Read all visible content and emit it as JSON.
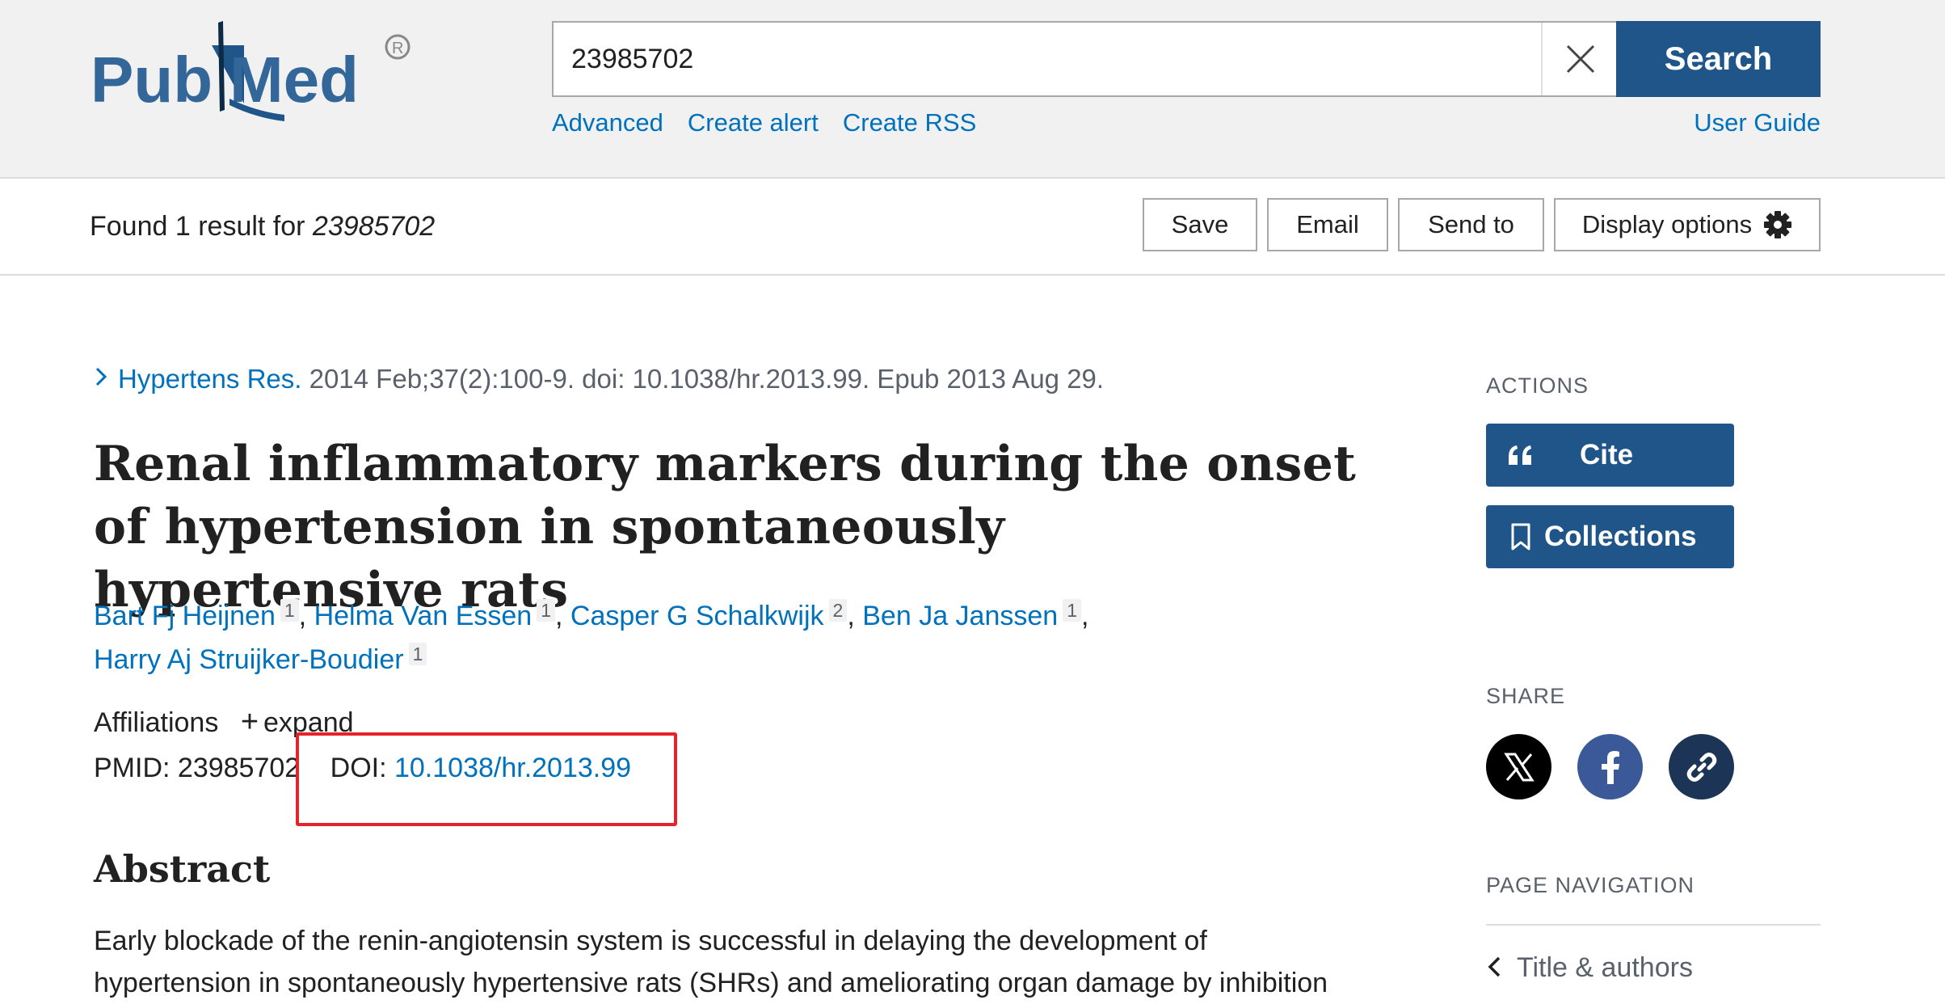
{
  "header": {
    "logo_text": "PubMed",
    "logo_mark": "®",
    "search_value": "23985702",
    "search_button": "Search",
    "links": [
      "Advanced",
      "Create alert",
      "Create RSS"
    ],
    "user_guide": "User Guide"
  },
  "results_bar": {
    "found_prefix": "Found 1 result for ",
    "found_query": "23985702",
    "buttons": {
      "save": "Save",
      "email": "Email",
      "send_to": "Send to",
      "display_options": "Display options"
    }
  },
  "article": {
    "journal": "Hypertens Res.",
    "citation_rest": " 2014 Feb;37(2):100-9. doi: 10.1038/hr.2013.99. Epub 2013 Aug 29.",
    "title": "Renal inflammatory markers during the onset of hypertension in spontaneously hypertensive rats",
    "authors": [
      {
        "name": "Bart Fj Heijnen",
        "aff": "1"
      },
      {
        "name": "Helma Van Essen",
        "aff": "1"
      },
      {
        "name": "Casper G Schalkwijk",
        "aff": "2"
      },
      {
        "name": "Ben Ja Janssen",
        "aff": "1"
      },
      {
        "name": "Harry Aj Struijker-Boudier",
        "aff": "1"
      }
    ],
    "affiliations_label": "Affiliations",
    "expand_label": "expand",
    "pmid_label": "PMID: ",
    "pmid": "23985702",
    "doi_label": "DOI: ",
    "doi": "10.1038/hr.2013.99",
    "abstract_heading": "Abstract",
    "abstract_line1": "Early blockade of the renin-angiotensin system is successful in delaying the development of",
    "abstract_line2": "hypertension in spontaneously hypertensive rats (SHRs) and ameliorating organ damage by inhibition"
  },
  "sidebar": {
    "actions_heading": "ACTIONS",
    "cite": "Cite",
    "collections": "Collections",
    "share_heading": "SHARE",
    "page_nav_heading": "PAGE NAVIGATION",
    "page_nav_item": "Title & authors"
  },
  "colors": {
    "brand_blue": "#20558a",
    "link_blue": "#0071bc",
    "highlight_red": "#e5232b",
    "facebook": "#3b5998",
    "x_black": "#000000",
    "link_share": "#1c3557"
  },
  "icons": [
    "clear-x-icon",
    "gear-icon",
    "chevron-right-icon",
    "plus-icon",
    "quote-icon",
    "bookmark-icon",
    "x-logo-icon",
    "facebook-icon",
    "link-icon",
    "chevron-left-icon"
  ]
}
